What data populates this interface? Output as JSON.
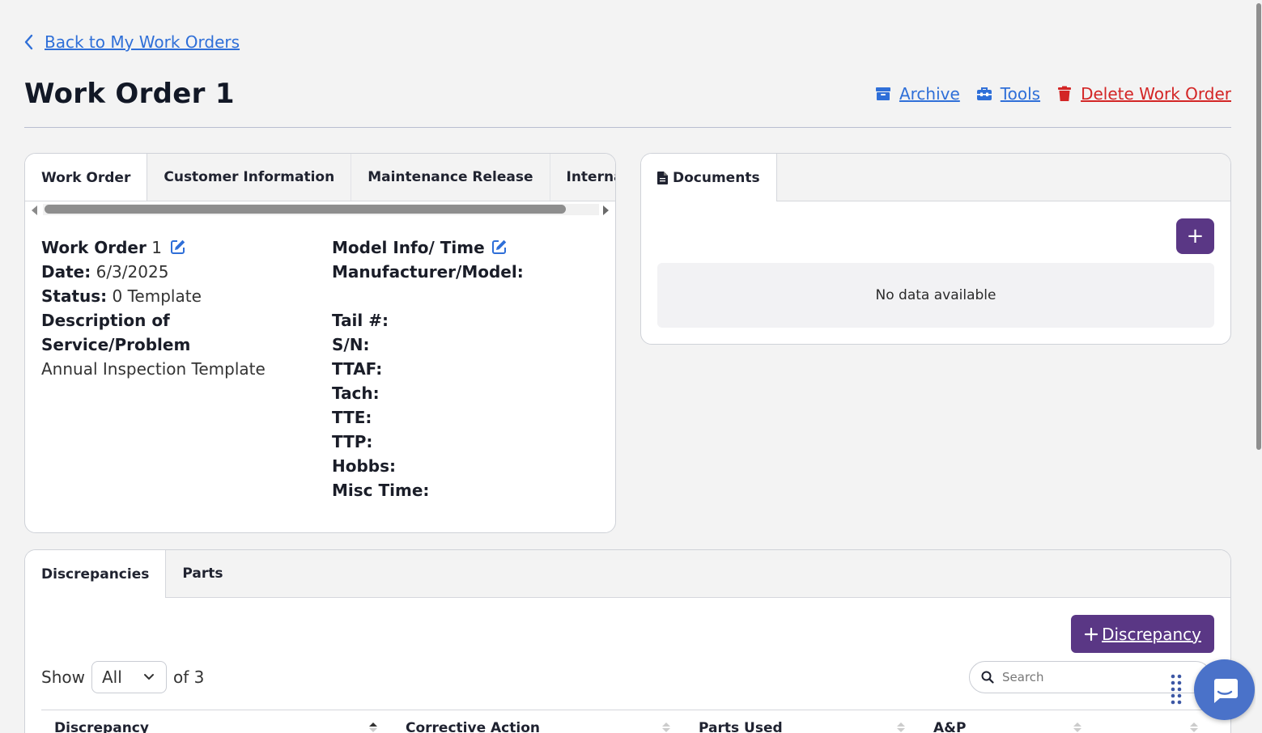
{
  "nav": {
    "back_label": "Back to My Work Orders"
  },
  "header": {
    "title": "Work Order 1",
    "actions": {
      "archive": "Archive",
      "tools": "Tools",
      "delete": "Delete Work Order"
    }
  },
  "work_order_card": {
    "tabs": [
      "Work Order",
      "Customer Information",
      "Maintenance Release",
      "Internal Notes"
    ],
    "active_tab": "Work Order",
    "left": {
      "work_order_label": "Work Order",
      "work_order_value": "1",
      "date_label": "Date:",
      "date_value": "6/3/2025",
      "status_label": "Status:",
      "status_value": "0 Template",
      "description_label": "Description of Service/Problem",
      "description_value": "Annual Inspection Template"
    },
    "right": {
      "model_info_label": "Model Info/ Time",
      "manufacturer_label": "Manufacturer/Model:",
      "tail_label": "Tail #:",
      "sn_label": "S/N:",
      "ttaf_label": "TTAF:",
      "tach_label": "Tach:",
      "tte_label": "TTE:",
      "ttp_label": "TTP:",
      "hobbs_label": "Hobbs:",
      "misc_label": "Misc Time:"
    }
  },
  "documents_card": {
    "tab_label": "Documents",
    "add_label": "+",
    "empty_text": "No data available"
  },
  "discrepancies_card": {
    "tabs": [
      "Discrepancies",
      "Parts"
    ],
    "add_button_label": "Discrepancy",
    "show_label": "Show",
    "page_size": "All",
    "of_label": "of 3",
    "search_placeholder": "Search",
    "columns": [
      "Discrepancy",
      "Corrective Action",
      "Parts Used",
      "A&P"
    ]
  },
  "colors": {
    "accent": "#5a3785",
    "link": "#2f6fd8",
    "danger": "#d32525"
  },
  "icons": [
    "chevron-left-icon",
    "archive-icon",
    "toolbox-icon",
    "trash-icon",
    "edit-icon",
    "file-icon",
    "search-icon",
    "chevron-down-icon",
    "chat-icon",
    "grid-dots-icon"
  ]
}
